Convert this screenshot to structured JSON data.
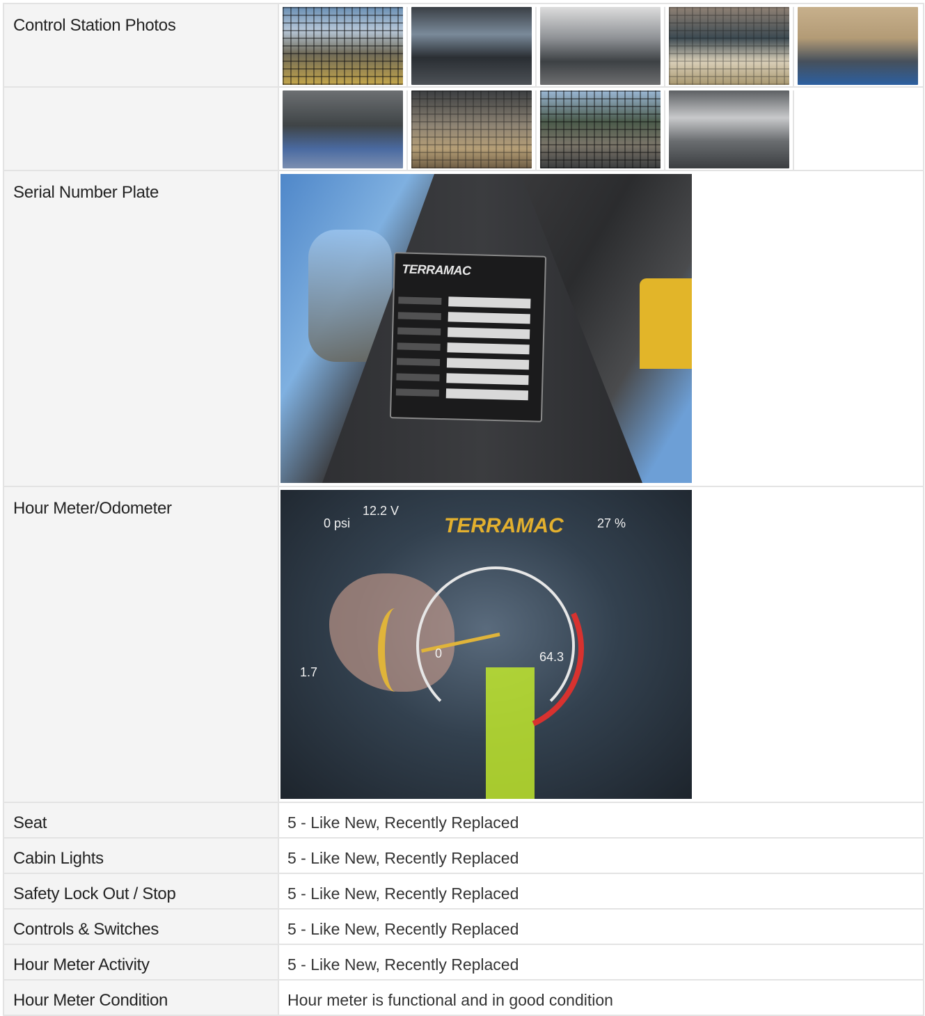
{
  "rows": {
    "control_station": {
      "label": "Control Station Photos"
    },
    "serial_plate": {
      "label": "Serial Number Plate"
    },
    "hour_meter_photo": {
      "label": "Hour Meter/Odometer"
    },
    "seat": {
      "label": "Seat",
      "value": "5 - Like New, Recently Replaced"
    },
    "cabin_lights": {
      "label": "Cabin Lights",
      "value": "5 - Like New, Recently Replaced"
    },
    "safety_lock": {
      "label": "Safety Lock Out / Stop",
      "value": "5 - Like New, Recently Replaced"
    },
    "controls_switches": {
      "label": "Controls & Switches",
      "value": "5 - Like New, Recently Replaced"
    },
    "hour_meter_activity": {
      "label": "Hour Meter Activity",
      "value": "5 - Like New, Recently Replaced"
    },
    "hour_meter_condition": {
      "label": "Hour Meter Condition",
      "value": "Hour meter is functional and in good condition"
    }
  },
  "serial_plate_photo": {
    "brand": "TERRAMAC"
  },
  "hour_meter_display": {
    "brand": "TERRAMAC",
    "voltage": "12.2 V",
    "pressure": "0 psi",
    "gauge_min": "0",
    "gauge_value": "64.3",
    "left_value": "1.7",
    "percent": "27 %"
  },
  "photo_icon": "photo-thumbnail"
}
